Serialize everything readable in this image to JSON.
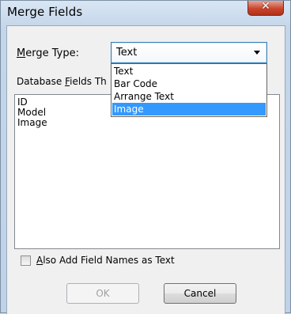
{
  "window": {
    "title": "Merge Fields",
    "close_glyph": "✕"
  },
  "merge_type": {
    "label_prefix": "",
    "label_mnemonic": "M",
    "label_rest": "erge Type:",
    "selected": "Text",
    "options": [
      "Text",
      "Bar Code",
      "Arrange Text",
      "Image"
    ],
    "highlighted_index": 3
  },
  "db_fields": {
    "label_prefix": "Database ",
    "label_mnemonic": "F",
    "label_rest": "ields Th",
    "items": [
      "ID",
      "Model",
      "Image"
    ]
  },
  "checkbox": {
    "label_mnemonic": "A",
    "label_rest": "lso Add Field Names as Text",
    "checked": false
  },
  "buttons": {
    "ok_label": "OK",
    "cancel_label": "Cancel",
    "ok_enabled": false
  },
  "icons": {
    "close": "close-icon",
    "dropdown": "chevron-down-icon"
  },
  "colors": {
    "selection": "#3399ff",
    "close_button": "#c9452c"
  }
}
